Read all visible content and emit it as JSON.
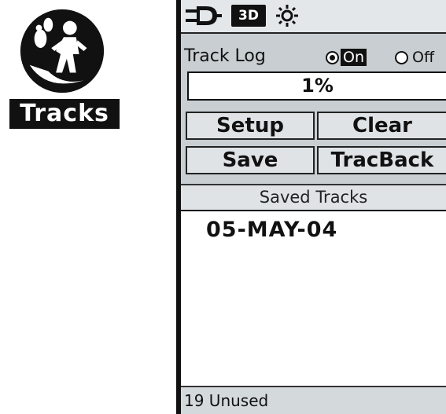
{
  "logo": {
    "label": "Tracks"
  },
  "status_bar": {
    "icons": [
      "power-plug-icon",
      "3d-gps-status-icon",
      "backlight-icon"
    ],
    "gps_status_text": "3D"
  },
  "track_log": {
    "label": "Track Log",
    "on_label": "On",
    "off_label": "Off",
    "selected": "On",
    "percent_full": "1%"
  },
  "buttons": {
    "setup": "Setup",
    "clear": "Clear",
    "save": "Save",
    "tracback": "TracBack"
  },
  "saved_tracks": {
    "header": "Saved Tracks",
    "items": [
      "05-MAY-04"
    ],
    "unused_text": "19 Unused"
  }
}
